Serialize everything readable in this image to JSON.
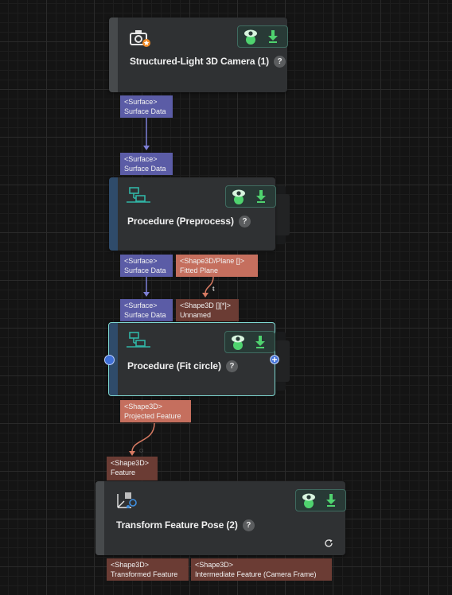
{
  "colors": {
    "background": "#141414",
    "node": "#2f3133",
    "surface_port": "#5b5ca6",
    "shape_port": "#c56f5e",
    "unconnected_port": "#6b3c34",
    "selected_border": "#7fd9d2",
    "visibility_green": "#4fd36f"
  },
  "nodes": [
    {
      "title": "Structured-Light 3D Camera (1)",
      "icon": "camera-icon",
      "help": "?",
      "outputs": [
        {
          "type": "<Surface>",
          "name": "Surface Data"
        }
      ]
    },
    {
      "title": "Procedure (Preprocess)",
      "icon": "procedure-icon",
      "help": "?",
      "inputs": [
        {
          "type": "<Surface>",
          "name": "Surface Data"
        }
      ],
      "outputs": [
        {
          "type": "<Surface>",
          "name": "Surface Data"
        },
        {
          "type": "<Shape3D/Plane []>",
          "name": "Fitted Plane"
        }
      ]
    },
    {
      "title": "Procedure (Fit circle)",
      "icon": "procedure-icon",
      "help": "?",
      "selected": true,
      "inputs": [
        {
          "type": "<Surface>",
          "name": "Surface Data"
        },
        {
          "type": "<Shape3D [][*]>",
          "name": "Unnamed"
        }
      ],
      "outputs": [
        {
          "type": "<Shape3D>",
          "name": "Projected Feature"
        }
      ]
    },
    {
      "title": "Transform Feature Pose (2)",
      "icon": "transform-pose-icon",
      "help": "?",
      "inputs": [
        {
          "type": "<Shape3D>",
          "name": "Feature"
        }
      ],
      "outputs": [
        {
          "type": "<Shape3D>",
          "name": "Transformed Feature"
        },
        {
          "type": "<Shape3D>",
          "name": "Intermediate Feature (Camera Frame)"
        }
      ]
    }
  ]
}
